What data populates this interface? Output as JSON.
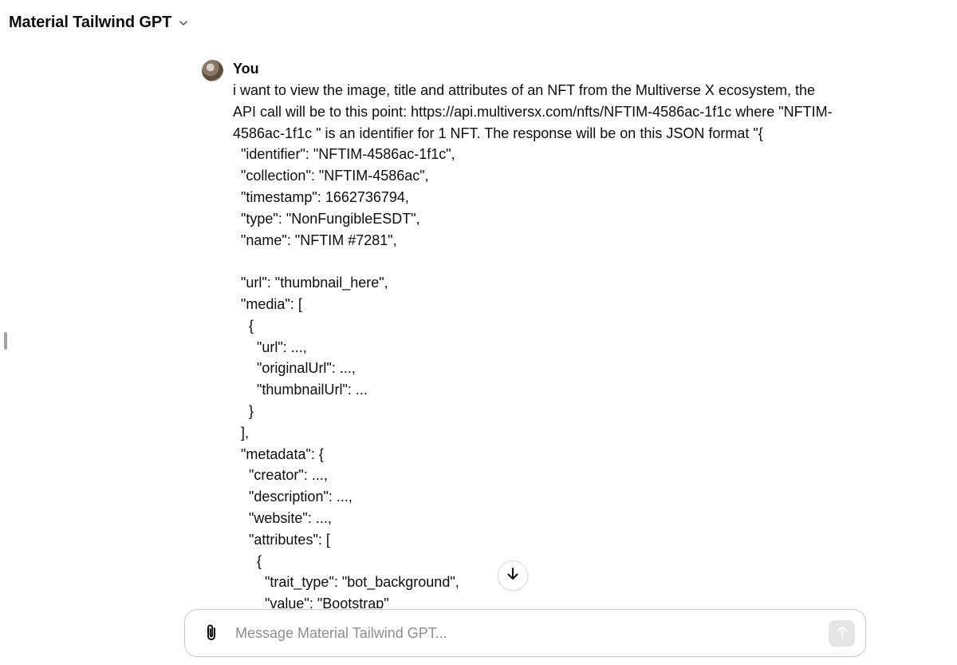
{
  "header": {
    "title": "Material Tailwind GPT",
    "chevron_icon": "chevron-down-icon"
  },
  "message": {
    "author": "You",
    "text": "i want to view the image, title and attributes of an NFT from the Multiverse X ecosystem, the API call will be to this point: https://api.multiversx.com/nfts/NFTIM-4586ac-1f1c where \"NFTIM-4586ac-1f1c \" is an identifier for 1 NFT. The response will be on this JSON format \"{\n  \"identifier\": \"NFTIM-4586ac-1f1c\",\n  \"collection\": \"NFTIM-4586ac\",\n  \"timestamp\": 1662736794,\n  \"type\": \"NonFungibleESDT\",\n  \"name\": \"NFTIM #7281\",\n\n  \"url\": \"thumbnail_here\",\n  \"media\": [\n    {\n      \"url\": ...,\n      \"originalUrl\": ...,\n      \"thumbnailUrl\": ...\n    }\n  ],\n  \"metadata\": {\n    \"creator\": ...,\n    \"description\": ...,\n    \"website\": ...,\n    \"attributes\": [\n      {\n        \"trait_type\": \"bot_background\",\n        \"value\": \"Bootstrap\""
  },
  "composer": {
    "placeholder": "Message Material Tailwind GPT..."
  },
  "icons": {
    "attach": "paperclip-icon",
    "send": "arrow-up-icon",
    "scroll": "arrow-down-icon"
  }
}
